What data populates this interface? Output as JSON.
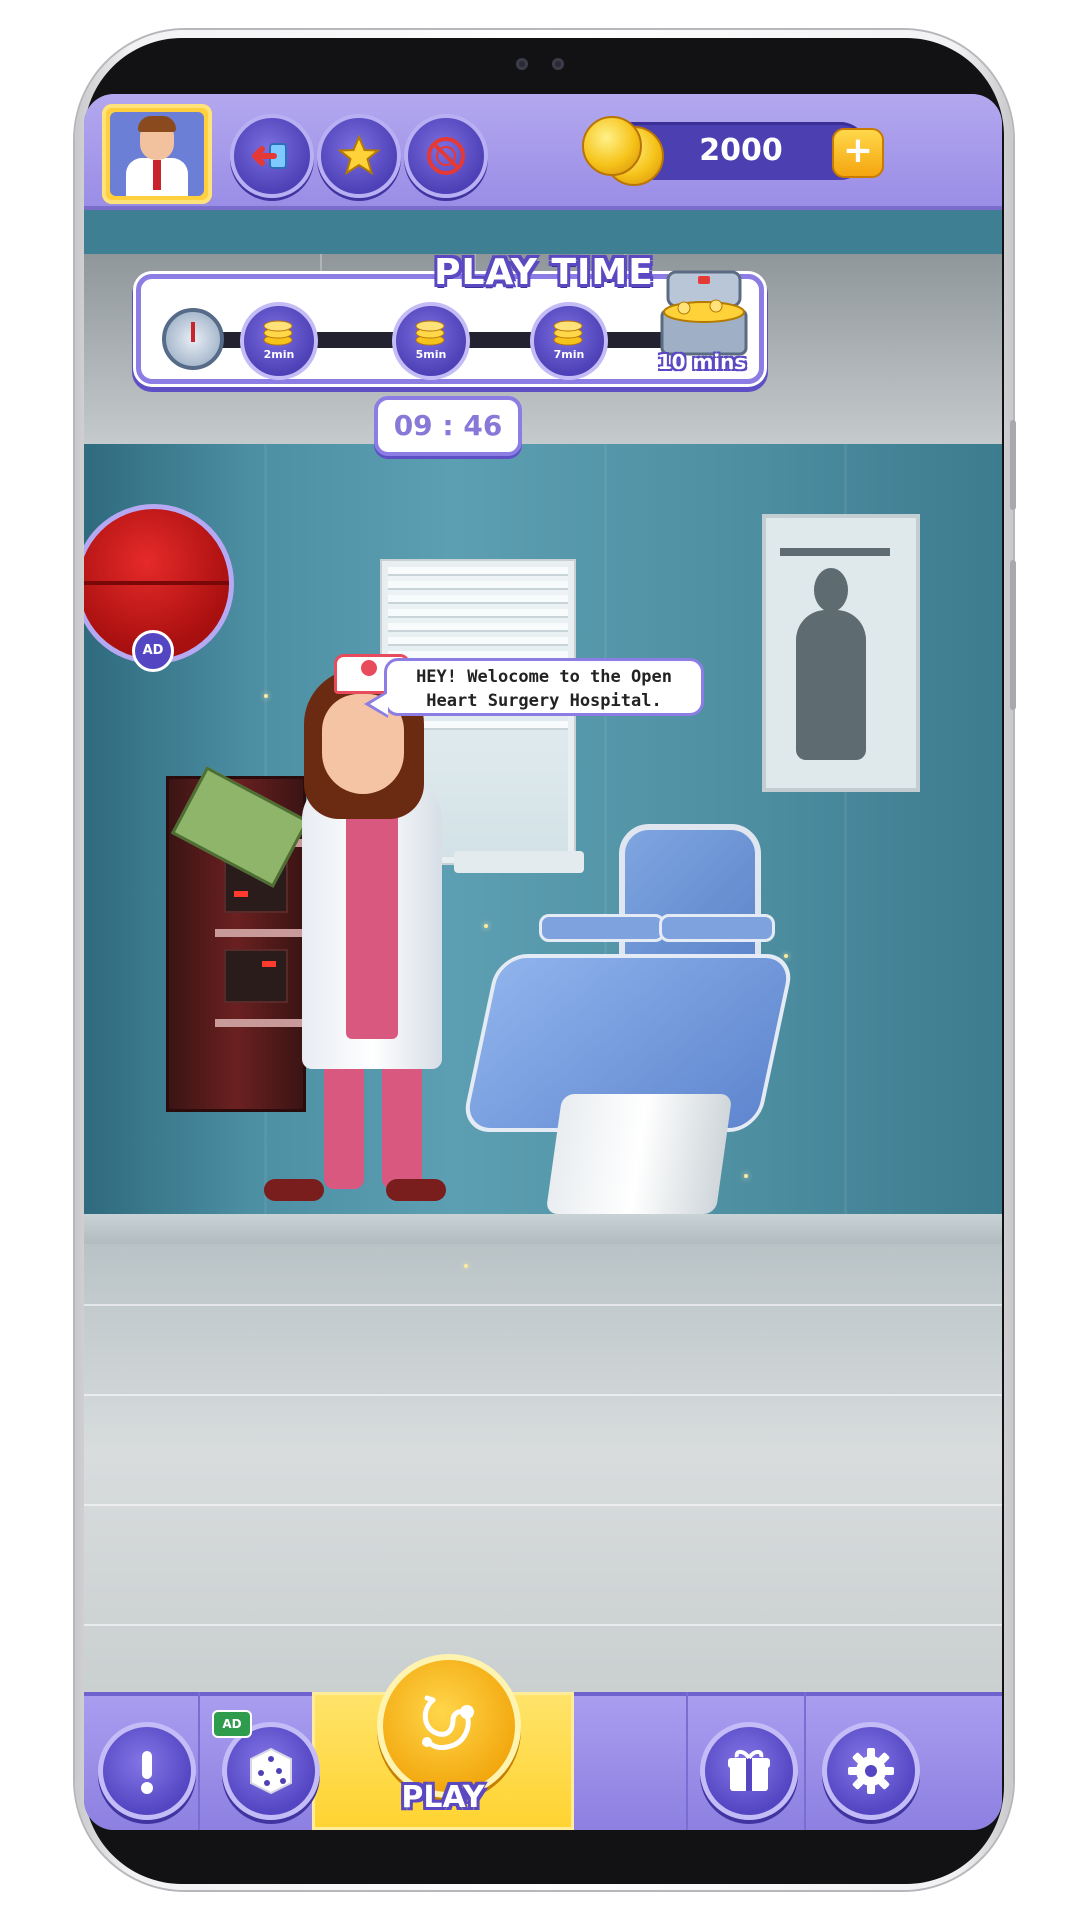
{
  "top_bar": {
    "coins": "2000",
    "plus_label": "+"
  },
  "play_time": {
    "title": "PLAY TIME",
    "milestones": [
      {
        "label": "2min"
      },
      {
        "label": "5min"
      },
      {
        "label": "7min"
      }
    ],
    "chest_label": "10 mins",
    "timer": "09 : 46"
  },
  "ad_circle": {
    "badge": "AD"
  },
  "speech": {
    "line1": "HEY! Welocome to the Open",
    "line2": "Heart Surgery Hospital."
  },
  "bottom_bar": {
    "dice_ad_tag": "AD",
    "play_label": "PLAY"
  },
  "colors": {
    "bar_purple": "#9a8de6",
    "button_purple": "#5446c2",
    "play_yellow": "#ffd330",
    "coin_gold": "#f6c31a"
  },
  "icons": [
    "avatar-doctor",
    "exit-icon",
    "star-icon",
    "no-ads-icon",
    "coins-icon",
    "stopwatch-icon",
    "coin-stack-icon",
    "treasure-chest-icon",
    "info-icon",
    "dice-icon",
    "stethoscope-icon",
    "gift-icon",
    "gear-icon"
  ]
}
